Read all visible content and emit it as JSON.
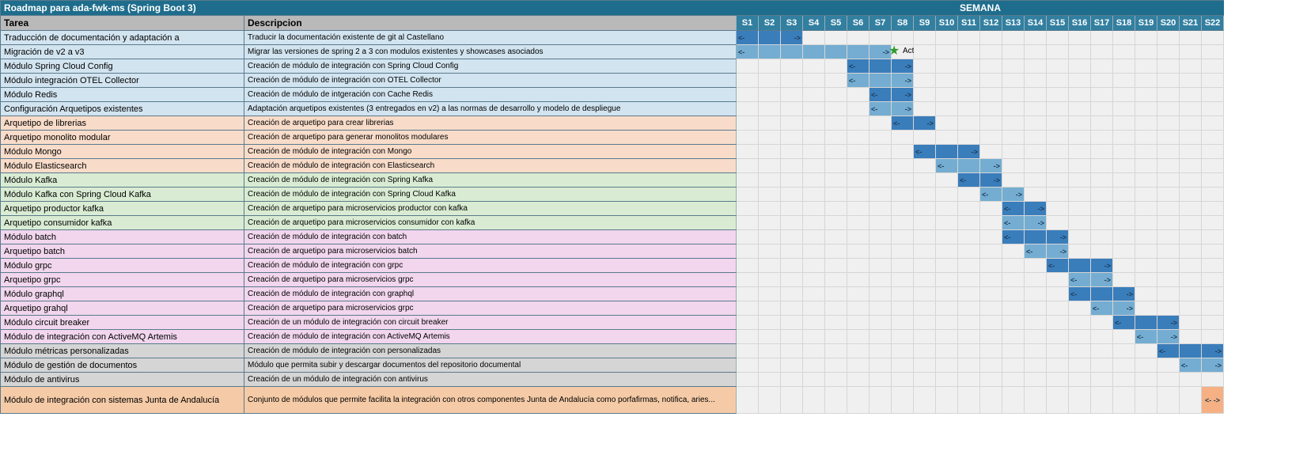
{
  "title": "Roadmap para ada-fwk-ms (Spring Boot 3)",
  "semana_label": "SEMANA",
  "headers": {
    "task": "Tarea",
    "desc": "Descripcion"
  },
  "weeks": [
    "S1",
    "S2",
    "S3",
    "S4",
    "S5",
    "S6",
    "S7",
    "S8",
    "S9",
    "S10",
    "S11",
    "S12",
    "S13",
    "S14",
    "S15",
    "S16",
    "S17",
    "S18",
    "S19",
    "S20",
    "S21",
    "S22"
  ],
  "milestone": {
    "row": 1,
    "week": 8,
    "text": "Activo adaptado y preparado para ser gobernado y utilizado"
  },
  "rows": [
    {
      "task": "Traducción de documentación y adaptación a",
      "desc": "Traducir la documentación existente de git al Castellano",
      "cat": "c-blue",
      "bars": [
        {
          "s": 1,
          "e": 3,
          "c": "bar-dark"
        }
      ]
    },
    {
      "task": "Migración de v2 a v3",
      "desc": "Migrar las versiones de spring 2 a 3 con modulos existentes y showcases asociados",
      "cat": "c-blue",
      "bars": [
        {
          "s": 1,
          "e": 7,
          "c": "bar-light"
        }
      ]
    },
    {
      "task": "Módulo Spring Cloud Config",
      "desc": "Creación de módulo de integración con Spring Cloud Config",
      "cat": "c-blue",
      "bars": [
        {
          "s": 6,
          "e": 8,
          "c": "bar-dark"
        }
      ]
    },
    {
      "task": "Módulo integración OTEL Collector",
      "desc": "Creación de módulo de integración con OTEL Collector",
      "cat": "c-blue",
      "bars": [
        {
          "s": 6,
          "e": 8,
          "c": "bar-light"
        }
      ]
    },
    {
      "task": "Módulo Redis",
      "desc": "Creación de módulo de intgeración con Cache Redis",
      "cat": "c-blue",
      "bars": [
        {
          "s": 7,
          "e": 8,
          "c": "bar-dark"
        }
      ]
    },
    {
      "task": "Configuración Arquetipos existentes",
      "desc": "Adaptación arquetipos existentes (3 entregados en v2) a las normas de desarrollo y modelo de despliegue",
      "cat": "c-blue",
      "bars": [
        {
          "s": 7,
          "e": 8,
          "c": "bar-light"
        }
      ]
    },
    {
      "task": "Arquetipo de librerias",
      "desc": "Creación de arquetipo para crear librerias",
      "cat": "c-orange",
      "bars": [
        {
          "s": 8,
          "e": 9,
          "c": "bar-dark"
        }
      ]
    },
    {
      "task": "Arquetipo monolito modular",
      "desc": "Creación de arquetipo para generar monolitos modulares",
      "cat": "c-orange",
      "bars": []
    },
    {
      "task": "Módulo Mongo",
      "desc": "Creación de módulo de integración con Mongo",
      "cat": "c-orange",
      "bars": [
        {
          "s": 9,
          "e": 11,
          "c": "bar-dark"
        }
      ]
    },
    {
      "task": "Módulo Elasticsearch",
      "desc": "Creación de módulo de integración con Elasticsearch",
      "cat": "c-orange",
      "bars": [
        {
          "s": 10,
          "e": 12,
          "c": "bar-light"
        }
      ]
    },
    {
      "task": "Módulo Kafka",
      "desc": "Creación de módulo de integración con Spring  Kafka",
      "cat": "c-green",
      "bars": [
        {
          "s": 11,
          "e": 12,
          "c": "bar-dark"
        }
      ]
    },
    {
      "task": "Módulo Kafka con Spring Cloud Kafka",
      "desc": "Creación de módulo de integración con Spring Cloud Kafka",
      "cat": "c-green",
      "bars": [
        {
          "s": 12,
          "e": 13,
          "c": "bar-light"
        }
      ]
    },
    {
      "task": "Arquetipo productor kafka",
      "desc": "Creación de arquetipo para microservicios productor con kafka",
      "cat": "c-green",
      "bars": [
        {
          "s": 13,
          "e": 14,
          "c": "bar-dark"
        }
      ]
    },
    {
      "task": "Arquetipo consumidor kafka",
      "desc": "Creación de arquetipo para microservicios consumidor con kafka",
      "cat": "c-green",
      "bars": [
        {
          "s": 13,
          "e": 14,
          "c": "bar-light"
        }
      ]
    },
    {
      "task": "Módulo batch",
      "desc": "Creación de módulo de integración con batch",
      "cat": "c-pink",
      "bars": [
        {
          "s": 13,
          "e": 15,
          "c": "bar-dark"
        }
      ]
    },
    {
      "task": "Arquetipo batch",
      "desc": "Creación de arquetipo para microservicios batch",
      "cat": "c-pink",
      "bars": [
        {
          "s": 14,
          "e": 15,
          "c": "bar-light"
        }
      ]
    },
    {
      "task": "Módulo grpc",
      "desc": "Creación de módulo de integración con grpc",
      "cat": "c-pink",
      "bars": [
        {
          "s": 15,
          "e": 17,
          "c": "bar-dark"
        }
      ]
    },
    {
      "task": "Arquetipo grpc",
      "desc": "Creación de arquetipo para microservicios grpc",
      "cat": "c-pink",
      "bars": [
        {
          "s": 16,
          "e": 17,
          "c": "bar-light"
        }
      ]
    },
    {
      "task": "Módulo graphql",
      "desc": "Creación de módulo de integración con graphql",
      "cat": "c-pink",
      "bars": [
        {
          "s": 16,
          "e": 18,
          "c": "bar-dark"
        }
      ]
    },
    {
      "task": "Arquetipo grahql",
      "desc": "Creación de arquetipo para microservicios grpc",
      "cat": "c-pink",
      "bars": [
        {
          "s": 17,
          "e": 18,
          "c": "bar-light"
        }
      ]
    },
    {
      "task": "Módulo circuit breaker",
      "desc": "Creación de un módulo de integración con circuit breaker",
      "cat": "c-pink",
      "bars": [
        {
          "s": 18,
          "e": 20,
          "c": "bar-dark"
        }
      ]
    },
    {
      "task": "Módulo de integración con ActiveMQ Artemis",
      "desc": "Creación de módulo de integración con ActiveMQ Artemis",
      "cat": "c-pink",
      "bars": [
        {
          "s": 19,
          "e": 20,
          "c": "bar-light"
        }
      ]
    },
    {
      "task": "Módulo métricas personalizadas",
      "desc": "Creación de módulo de integración con personalizadas",
      "cat": "c-gray",
      "bars": [
        {
          "s": 20,
          "e": 22,
          "c": "bar-dark"
        }
      ]
    },
    {
      "task": "Módulo de gestión de documentos",
      "desc": "Módulo que permita subir y descargar documentos del repositorio documental",
      "cat": "c-gray",
      "bars": [
        {
          "s": 21,
          "e": 22,
          "c": "bar-light"
        }
      ]
    },
    {
      "task": "Módulo de antivirus",
      "desc": "Creación de un módulo de integración con antivirus",
      "cat": "c-gray",
      "bars": []
    },
    {
      "task": "Módulo de integración con sistemas Junta de Andalucía",
      "desc": "Conjunto de módulos que permite facilita la integración con otros componentes Junta de Andalucía como porfafirmas, notifica, aries...",
      "cat": "c-orange2",
      "tall": true,
      "bars": [
        {
          "s": 22,
          "e": 22,
          "c": "bar-or"
        }
      ]
    }
  ],
  "chart_data": {
    "type": "bar",
    "title": "Roadmap para ada-fwk-ms (Spring Boot 3)",
    "xlabel": "Semana",
    "ylabel": "Tarea",
    "categories": [
      "S1",
      "S2",
      "S3",
      "S4",
      "S5",
      "S6",
      "S7",
      "S8",
      "S9",
      "S10",
      "S11",
      "S12",
      "S13",
      "S14",
      "S15",
      "S16",
      "S17",
      "S18",
      "S19",
      "S20",
      "S21",
      "S22"
    ],
    "series": [
      {
        "name": "Traducción de documentación y adaptación a",
        "start": 1,
        "end": 3
      },
      {
        "name": "Migración de v2 a v3",
        "start": 1,
        "end": 7
      },
      {
        "name": "Módulo Spring Cloud Config",
        "start": 6,
        "end": 8
      },
      {
        "name": "Módulo integración OTEL Collector",
        "start": 6,
        "end": 8
      },
      {
        "name": "Módulo Redis",
        "start": 7,
        "end": 8
      },
      {
        "name": "Configuración Arquetipos existentes",
        "start": 7,
        "end": 8
      },
      {
        "name": "Arquetipo de librerias",
        "start": 8,
        "end": 9
      },
      {
        "name": "Arquetipo monolito modular",
        "start": null,
        "end": null
      },
      {
        "name": "Módulo Mongo",
        "start": 9,
        "end": 11
      },
      {
        "name": "Módulo Elasticsearch",
        "start": 10,
        "end": 12
      },
      {
        "name": "Módulo Kafka",
        "start": 11,
        "end": 12
      },
      {
        "name": "Módulo Kafka con Spring Cloud Kafka",
        "start": 12,
        "end": 13
      },
      {
        "name": "Arquetipo productor kafka",
        "start": 13,
        "end": 14
      },
      {
        "name": "Arquetipo consumidor kafka",
        "start": 13,
        "end": 14
      },
      {
        "name": "Módulo batch",
        "start": 13,
        "end": 15
      },
      {
        "name": "Arquetipo batch",
        "start": 14,
        "end": 15
      },
      {
        "name": "Módulo grpc",
        "start": 15,
        "end": 17
      },
      {
        "name": "Arquetipo grpc",
        "start": 16,
        "end": 17
      },
      {
        "name": "Módulo graphql",
        "start": 16,
        "end": 18
      },
      {
        "name": "Arquetipo grahql",
        "start": 17,
        "end": 18
      },
      {
        "name": "Módulo circuit breaker",
        "start": 18,
        "end": 20
      },
      {
        "name": "Módulo de integración con ActiveMQ Artemis",
        "start": 19,
        "end": 20
      },
      {
        "name": "Módulo métricas personalizadas",
        "start": 20,
        "end": 22
      },
      {
        "name": "Módulo de gestión de documentos",
        "start": 21,
        "end": 22
      },
      {
        "name": "Módulo de antivirus",
        "start": null,
        "end": null
      },
      {
        "name": "Módulo de integración con sistemas Junta de Andalucía",
        "start": 22,
        "end": 22
      }
    ],
    "milestones": [
      {
        "week": 8,
        "label": "Activo adaptado y preparado para ser gobernado y utilizado"
      }
    ],
    "xlim": [
      1,
      22
    ]
  }
}
